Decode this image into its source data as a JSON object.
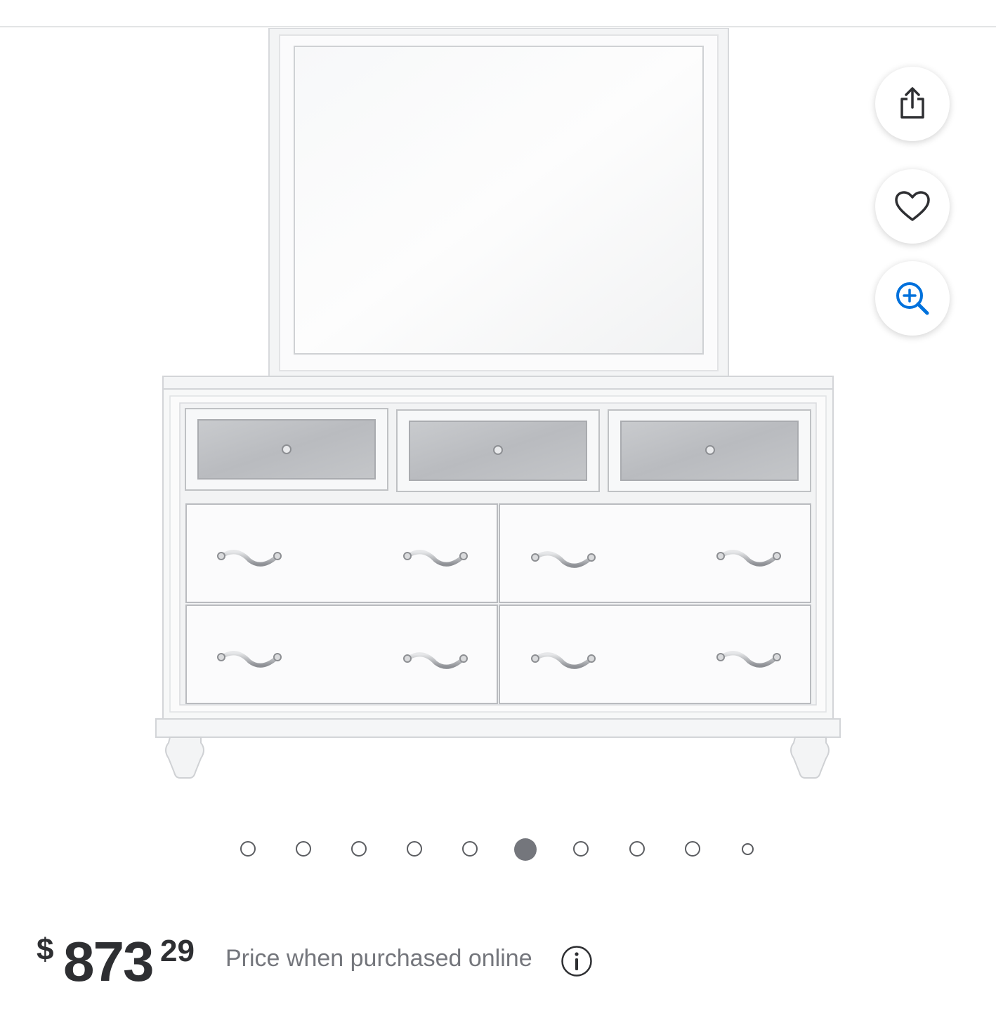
{
  "header": {
    "divider": true
  },
  "product_image": {
    "alt": "dresser-with-mirror-photo",
    "icon": "product-photo"
  },
  "actions": {
    "share": {
      "icon": "share-icon"
    },
    "favorite": {
      "icon": "heart-icon"
    },
    "zoom": {
      "icon": "zoom-in-icon",
      "color": "#0071dc"
    }
  },
  "carousel": {
    "total_dots": 10,
    "active_index": 5
  },
  "price": {
    "currency": "$",
    "dollars": "873",
    "cents": "29",
    "note": "Price when purchased online",
    "info_icon": "info-icon"
  },
  "colors": {
    "text": "#2e2f32",
    "muted": "#74767c",
    "accent": "#0071dc"
  }
}
